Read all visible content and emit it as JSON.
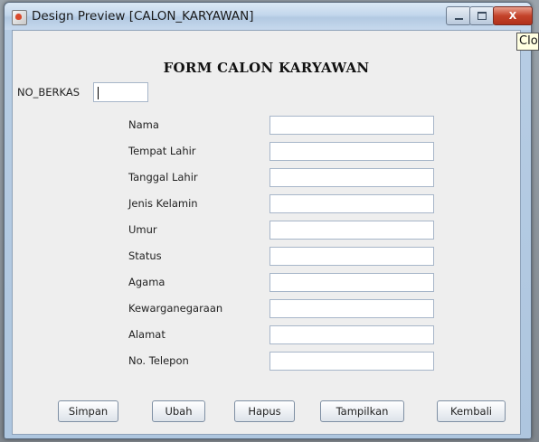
{
  "window": {
    "title": "Design Preview [CALON_KARYAWAN]",
    "close_symbol": "X"
  },
  "tooltip": {
    "text": "Clo"
  },
  "form": {
    "title": "FORM CALON KARYAWAN",
    "no_berkas_label": "NO_BERKAS",
    "fields": [
      {
        "label": "Nama",
        "value": ""
      },
      {
        "label": "Tempat Lahir",
        "value": ""
      },
      {
        "label": "Tanggal Lahir",
        "value": ""
      },
      {
        "label": "Jenis Kelamin",
        "value": ""
      },
      {
        "label": "Umur",
        "value": ""
      },
      {
        "label": "Status",
        "value": ""
      },
      {
        "label": "Agama",
        "value": ""
      },
      {
        "label": "Kewarganegaraan",
        "value": ""
      },
      {
        "label": "Alamat",
        "value": ""
      },
      {
        "label": "No. Telepon",
        "value": ""
      }
    ]
  },
  "buttons": {
    "simpan": "Simpan",
    "ubah": "Ubah",
    "hapus": "Hapus",
    "tampilkan": "Tampilkan",
    "kembali": "Kembali"
  }
}
